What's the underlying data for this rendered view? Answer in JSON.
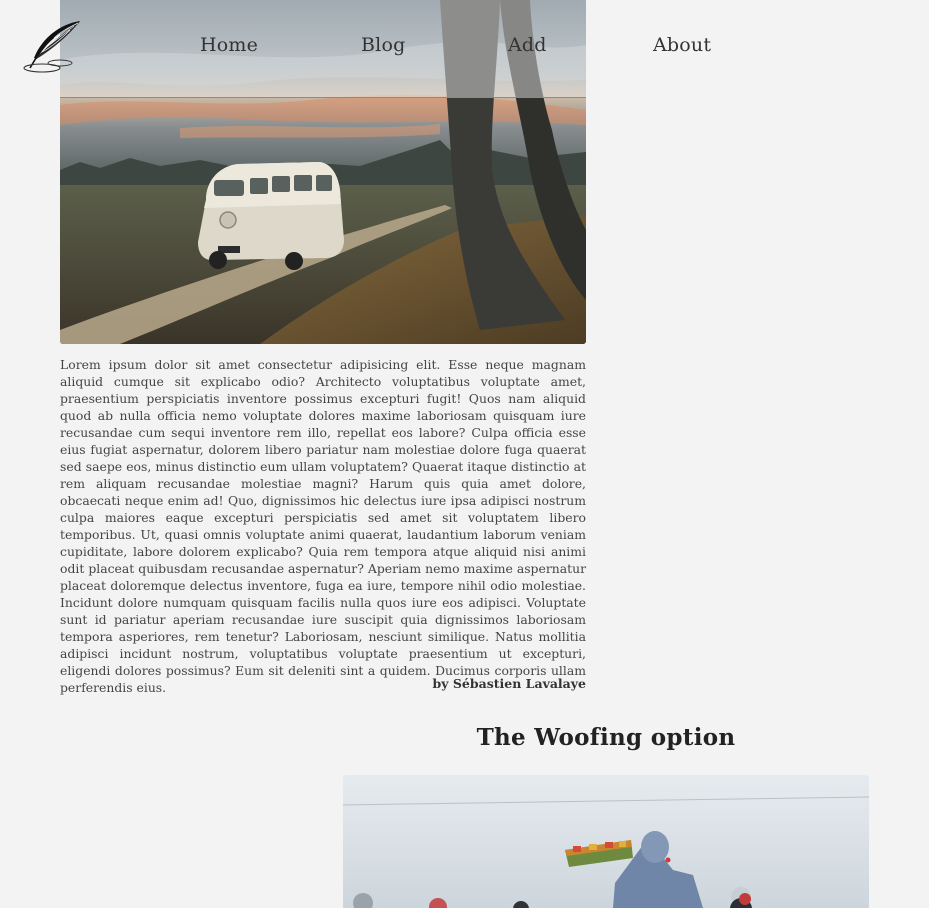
{
  "nav": {
    "logo_icon": "feather-quill-icon",
    "items": [
      {
        "label": "Home"
      },
      {
        "label": "Blog"
      },
      {
        "label": "Add"
      },
      {
        "label": "About"
      }
    ]
  },
  "article": {
    "image_icon": "van-landscape-image",
    "body": "Lorem ipsum dolor sit amet consectetur adipisicing elit. Esse neque magnam aliquid cumque sit explicabo odio? Architecto voluptatibus voluptate amet, praesentium perspiciatis inventore possimus excepturi fugit! Quos nam aliquid quod ab nulla officia nemo voluptate dolores maxime laboriosam quisquam iure recusandae cum sequi inventore rem illo, repellat eos labore? Culpa officia esse eius fugiat aspernatur, dolorem libero pariatur nam molestiae dolore fuga quaerat sed saepe eos, minus distinctio eum ullam voluptatem? Quaerat itaque distinctio at rem aliquam recusandae molestiae magni? Harum quis quia amet dolore, obcaecati neque enim ad! Quo, dignissimos hic delectus iure ipsa adipisci nostrum culpa maiores eaque excepturi perspiciatis sed amet sit voluptatem libero temporibus. Ut, quasi omnis voluptate animi quaerat, laudantium laborum veniam cupiditate, labore dolorem explicabo? Quia rem tempora atque aliquid nisi animi odit placeat quibusdam recusandae aspernatur? Aperiam nemo maxime aspernatur placeat doloremque delectus inventore, fuga ea iure, tempore nihil odio molestiae. Incidunt dolore numquam quisquam facilis nulla quos iure eos adipisci. Voluptate sunt id pariatur aperiam recusandae iure suscipit quia dignissimos laboriosam tempora asperiores, rem tenetur? Laboriosam, nesciunt similique. Natus mollitia adipisci incidunt nostrum, voluptatibus voluptate praesentium ut excepturi, eligendi dolores possimus? Eum sit deleniti sint a quidem. Ducimus corporis ullam perferendis eius.",
    "author": "by Sébastien Lavalaye"
  },
  "second_article": {
    "title": "The Woofing option",
    "image_icon": "farm-worker-image"
  },
  "colors": {
    "background": "#f3f3f3",
    "text": "#333333",
    "header_rule": "#333333"
  }
}
